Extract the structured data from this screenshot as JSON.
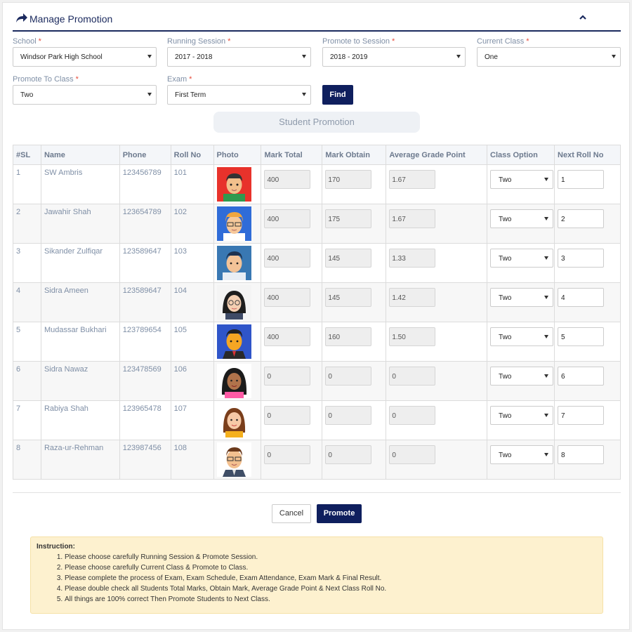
{
  "header": {
    "title": "Manage Promotion"
  },
  "filters": {
    "school": {
      "label": "School",
      "required": "*",
      "value": "Windsor Park High School"
    },
    "running_session": {
      "label": "Running Session",
      "required": "*",
      "value": "2017 - 2018"
    },
    "promote_to_session": {
      "label": "Promote to Session",
      "required": "*",
      "value": "2018 - 2019"
    },
    "current_class": {
      "label": "Current Class",
      "required": "*",
      "value": "One"
    },
    "promote_to_class": {
      "label": "Promote To Class",
      "required": "*",
      "value": "Two"
    },
    "exam": {
      "label": "Exam",
      "required": "*",
      "value": "First Term"
    },
    "find_label": "Find"
  },
  "section_title": "Student Promotion",
  "table": {
    "columns": [
      "#SL",
      "Name",
      "Phone",
      "Roll No",
      "Photo",
      "Mark Total",
      "Mark Obtain",
      "Average Grade Point",
      "Class Option",
      "Next Roll No"
    ],
    "rows": [
      {
        "sl": "1",
        "name": "SW Ambris",
        "phone": "123456789",
        "roll": "101",
        "photo": "avatar-boy-red-bg",
        "total": "400",
        "obtain": "170",
        "agp": "1.67",
        "class_option": "Two",
        "next_roll": "1"
      },
      {
        "sl": "2",
        "name": "Jawahir Shah",
        "phone": "123654789",
        "roll": "102",
        "photo": "avatar-man-glasses-blue-bg",
        "total": "400",
        "obtain": "175",
        "agp": "1.67",
        "class_option": "Two",
        "next_roll": "2"
      },
      {
        "sl": "3",
        "name": "Sikander Zulfiqar",
        "phone": "123589647",
        "roll": "103",
        "photo": "avatar-man-blue-bg",
        "total": "400",
        "obtain": "145",
        "agp": "1.33",
        "class_option": "Two",
        "next_roll": "3"
      },
      {
        "sl": "4",
        "name": "Sidra Ameen",
        "phone": "123589647",
        "roll": "104",
        "photo": "avatar-woman-glasses",
        "total": "400",
        "obtain": "145",
        "agp": "1.42",
        "class_option": "Two",
        "next_roll": "4"
      },
      {
        "sl": "5",
        "name": "Mudassar Bukhari",
        "phone": "123789654",
        "roll": "105",
        "photo": "avatar-man-suit-blue-bg",
        "total": "400",
        "obtain": "160",
        "agp": "1.50",
        "class_option": "Two",
        "next_roll": "5"
      },
      {
        "sl": "6",
        "name": "Sidra Nawaz",
        "phone": "123478569",
        "roll": "106",
        "photo": "avatar-woman-dark-hair",
        "total": "0",
        "obtain": "0",
        "agp": "0",
        "class_option": "Two",
        "next_roll": "6"
      },
      {
        "sl": "7",
        "name": "Rabiya Shah",
        "phone": "123965478",
        "roll": "107",
        "photo": "avatar-woman-brown-hair",
        "total": "0",
        "obtain": "0",
        "agp": "0",
        "class_option": "Two",
        "next_roll": "7"
      },
      {
        "sl": "8",
        "name": "Raza-ur-Rehman",
        "phone": "123987456",
        "roll": "108",
        "photo": "avatar-man-glasses-suit",
        "total": "0",
        "obtain": "0",
        "agp": "0",
        "class_option": "Two",
        "next_roll": "8"
      }
    ]
  },
  "actions": {
    "cancel": "Cancel",
    "promote": "Promote"
  },
  "instruction": {
    "heading": "Instruction:",
    "items": [
      "Please choose carefully Running Session & Promote Session.",
      "Please choose carefully Current Class & Promote to Class.",
      "Please complete the process of Exam, Exam Schedule, Exam Attendance, Exam Mark & Final Result.",
      "Please double check all Students Total Marks, Obtain Mark, Average Grade Point & Next Class Roll No.",
      "All things are 100% correct Then Promote Students to Next Class."
    ]
  },
  "colors": {
    "brand": "#0f1f5e",
    "required": "#e74c3c",
    "notice_bg": "#fdf1cf"
  }
}
